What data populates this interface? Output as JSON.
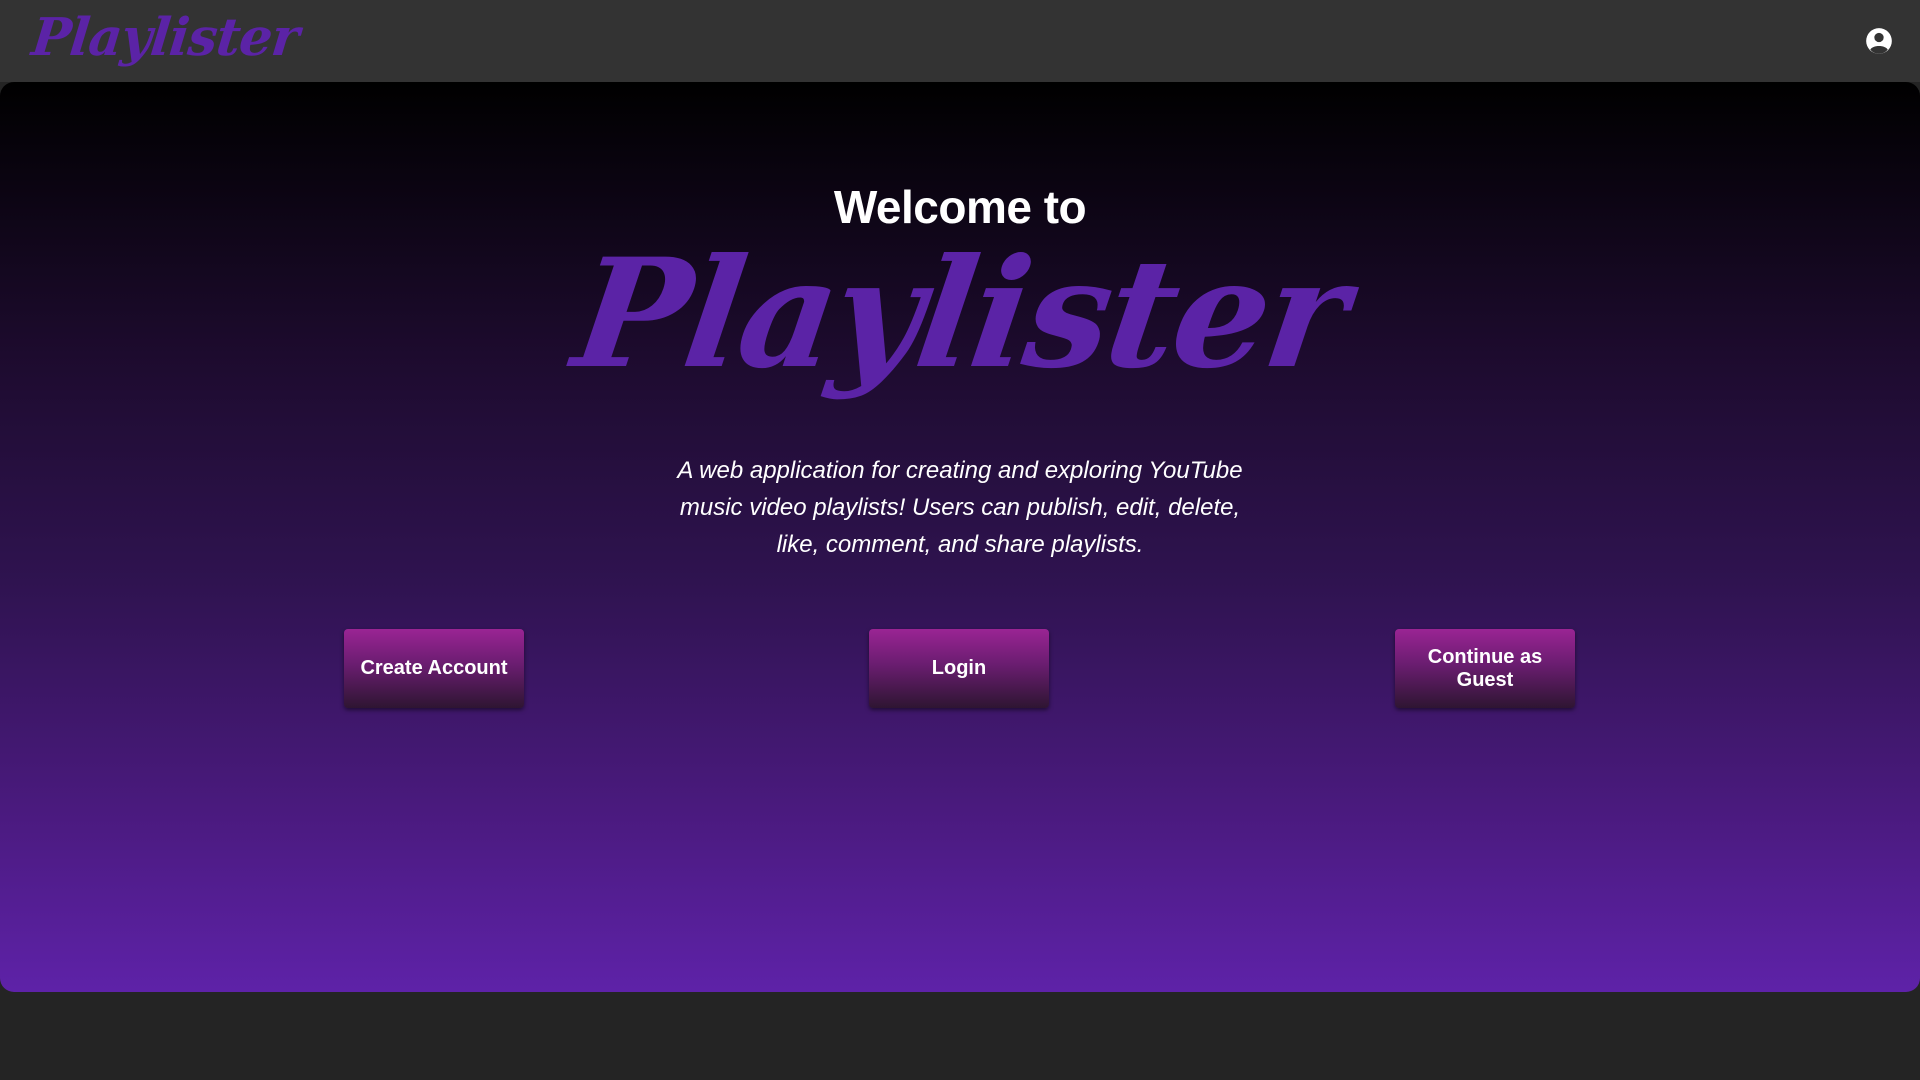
{
  "app": {
    "brand": "Playlister",
    "brand_color": "#5b23a6"
  },
  "topbar": {
    "account_icon": "account-circle-icon"
  },
  "hero": {
    "welcome": "Welcome to",
    "brand": "Playlister",
    "tagline": "A web application for creating and exploring YouTube music video playlists! Users can publish, edit, delete, like, comment, and share playlists."
  },
  "buttons": {
    "create_account": "Create Account",
    "login": "Login",
    "continue_guest": "Continue as Guest"
  }
}
